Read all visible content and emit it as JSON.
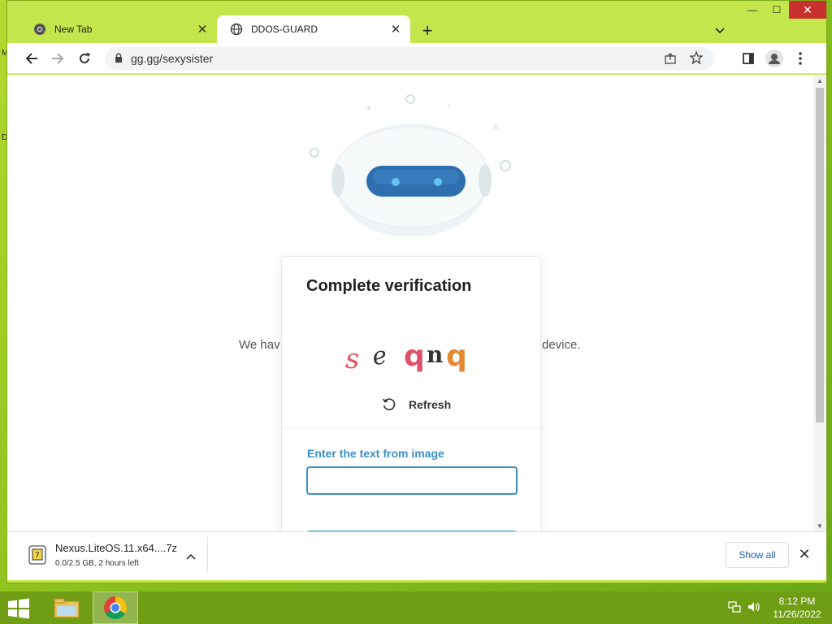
{
  "desktop": {
    "side_letters": [
      "M",
      "D"
    ]
  },
  "browser": {
    "tabs": [
      {
        "label": "New Tab",
        "icon": "chrome-icon",
        "active": false
      },
      {
        "label": "DDOS-GUARD",
        "icon": "globe-icon",
        "active": true
      }
    ],
    "address": "gg.gg/sexysister"
  },
  "page": {
    "background_text_left": "We hav",
    "background_text_right": "device.",
    "card": {
      "title": "Complete verification",
      "captcha_text": [
        "s",
        "e",
        "q",
        "n",
        "q"
      ],
      "refresh_label": "Refresh",
      "field_label": "Enter the text from image",
      "input_value": ""
    }
  },
  "downloads": {
    "file_name": "Nexus.LiteOS.11.x64....7z",
    "status": "0.0/2.5 GB, 2 hours left",
    "show_all_label": "Show all"
  },
  "taskbar": {
    "time": "8:12 PM",
    "date": "11/26/2022"
  },
  "colors": {
    "accent": "#3a8fc4",
    "desktop": "#8ec21f",
    "close_red": "#c8312d"
  }
}
